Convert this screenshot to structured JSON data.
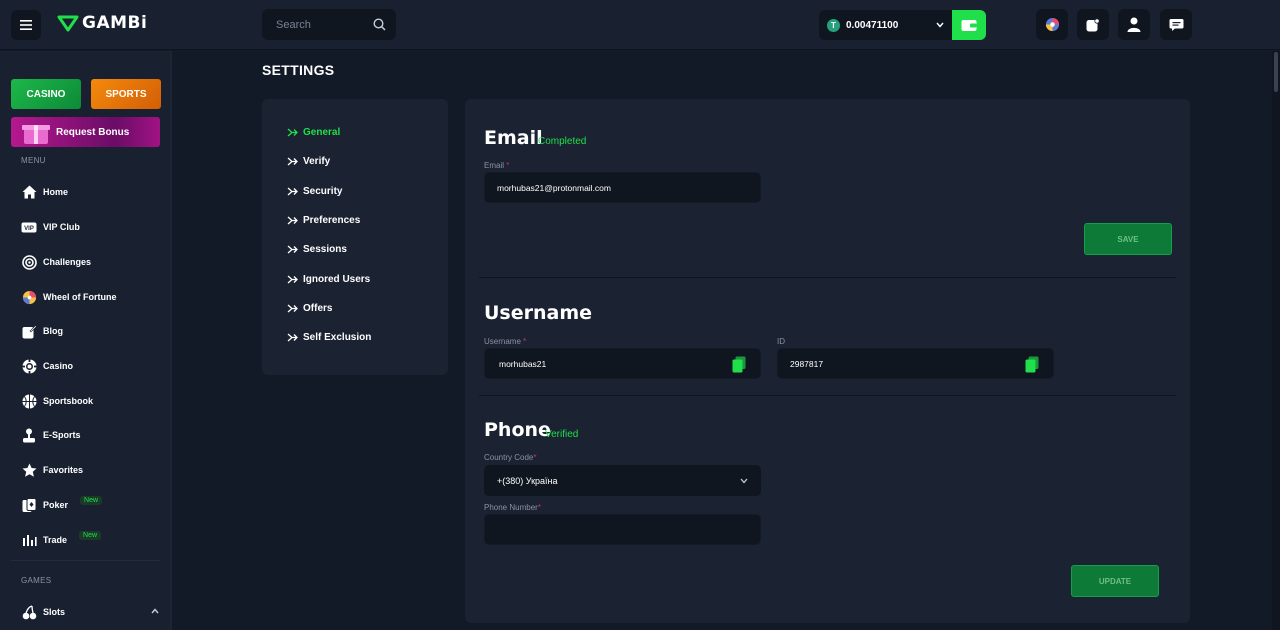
{
  "header": {
    "logo_text": "GAMBi",
    "search_placeholder": "Search",
    "balance": "0.00471100",
    "currency_icon": "tether-icon",
    "accent_color": "#1fe04a"
  },
  "sidebar": {
    "promos": {
      "casino": "CASINO",
      "sports": "SPORTS",
      "bonus": "Request Bonus"
    },
    "menu_label": "MENU",
    "items": [
      {
        "label": "Home",
        "icon": "home-icon"
      },
      {
        "label": "VIP Club",
        "icon": "vip-icon"
      },
      {
        "label": "Challenges",
        "icon": "target-icon"
      },
      {
        "label": "Wheel of Fortune",
        "icon": "wheel-icon"
      },
      {
        "label": "Blog",
        "icon": "blog-icon"
      },
      {
        "label": "Casino",
        "icon": "casino-chip-icon"
      },
      {
        "label": "Sportsbook",
        "icon": "basketball-icon"
      },
      {
        "label": "E-Sports",
        "icon": "joystick-icon"
      },
      {
        "label": "Favorites",
        "icon": "star-icon"
      },
      {
        "label": "Poker",
        "icon": "cards-icon",
        "badge": "New"
      },
      {
        "label": "Trade",
        "icon": "chart-icon",
        "badge": "New"
      }
    ],
    "games_label": "GAMES",
    "games_items": [
      {
        "label": "Slots",
        "icon": "cherry-icon"
      }
    ]
  },
  "page": {
    "title": "SETTINGS"
  },
  "settings_nav": [
    {
      "label": "General",
      "active": true
    },
    {
      "label": "Verify"
    },
    {
      "label": "Security"
    },
    {
      "label": "Preferences"
    },
    {
      "label": "Sessions"
    },
    {
      "label": "Ignored Users"
    },
    {
      "label": "Offers"
    },
    {
      "label": "Self Exclusion"
    }
  ],
  "email_section": {
    "title": "Email",
    "status": "Completed",
    "field_label": "Email",
    "value": "morhubas21@protonmail.com",
    "save_label": "SAVE"
  },
  "username_section": {
    "title": "Username",
    "username_label": "Username",
    "username_value": "morhubas21",
    "id_label": "ID",
    "id_value": "2987817"
  },
  "phone_section": {
    "title": "Phone",
    "status": "Verified",
    "country_label": "Country Code",
    "country_value": "+(380) Україна",
    "phone_label": "Phone Number",
    "phone_value": "",
    "update_label": "UPDATE"
  }
}
